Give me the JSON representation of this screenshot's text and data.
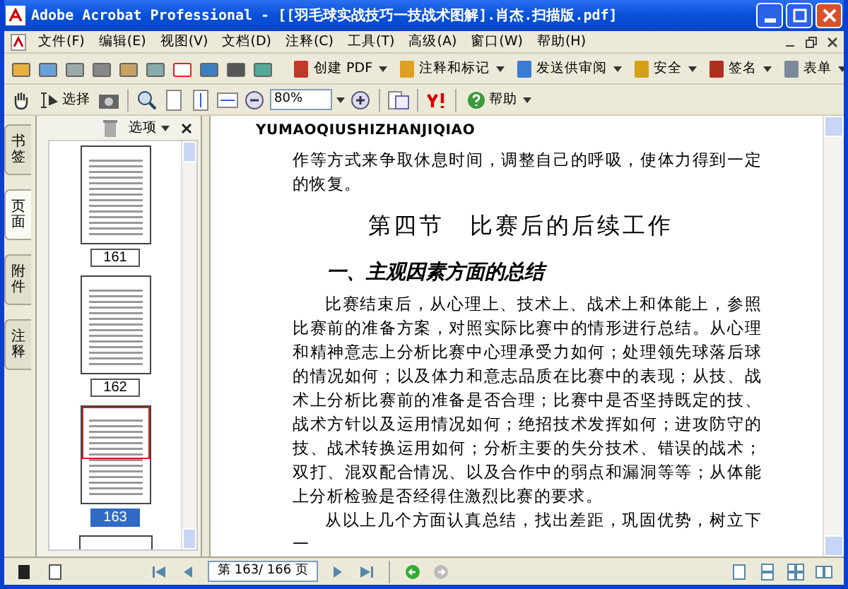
{
  "window": {
    "title": "Adobe Acrobat Professional - [[羽毛球实战技巧一技战术图解].肖杰.扫描版.pdf]"
  },
  "menu": [
    {
      "label": "文件(F)"
    },
    {
      "label": "编辑(E)"
    },
    {
      "label": "视图(V)"
    },
    {
      "label": "文档(D)"
    },
    {
      "label": "注释(C)"
    },
    {
      "label": "工具(T)"
    },
    {
      "label": "高级(A)"
    },
    {
      "label": "窗口(W)"
    },
    {
      "label": "帮助(H)"
    }
  ],
  "task_buttons": [
    {
      "label": "创建 PDF",
      "kind": "pdf"
    },
    {
      "label": "注释和标记",
      "kind": "comment"
    },
    {
      "label": "发送供审阅",
      "kind": "review"
    },
    {
      "label": "安全",
      "kind": "lock"
    },
    {
      "label": "签名",
      "kind": "pen"
    },
    {
      "label": "表单",
      "kind": "form"
    }
  ],
  "select_tool": {
    "label": "选择"
  },
  "zoom": {
    "value": "80%"
  },
  "help": {
    "label": "帮助"
  },
  "sidebar": {
    "tabs": [
      {
        "label": "书签",
        "selected": false
      },
      {
        "label": "页面",
        "selected": true
      },
      {
        "label": "附件",
        "selected": false
      },
      {
        "label": "注释",
        "selected": false
      }
    ],
    "options": "选项",
    "thumbnails": [
      {
        "label": "161",
        "selected": false
      },
      {
        "label": "162",
        "selected": false
      },
      {
        "label": "163",
        "selected": true
      }
    ]
  },
  "document": {
    "running_head": "YUMAOQIUSHIZHANJIQIAO",
    "blocks": [
      {
        "kind": "para",
        "indent": false,
        "text": "作等方式来争取休息时间，调整自己的呼吸，使体力得到一定的恢复。"
      },
      {
        "kind": "section",
        "text": "第四节　比赛后的后续工作"
      },
      {
        "kind": "subheading",
        "text": "一、主观因素方面的总结"
      },
      {
        "kind": "para",
        "indent": true,
        "text": "比赛结束后，从心理上、技术上、战术上和体能上，参照比赛前的准备方案，对照实际比赛中的情形进行总结。从心理和精神意志上分析比赛中心理承受力如何；处理领先球落后球的情况如何；以及体力和意志品质在比赛中的表现；从技、战术上分析比赛前的准备是否合理；比赛中是否坚持既定的技、战术方针以及运用情况如何；绝招技术发挥如何；进攻防守的技、战术转换运用如何；分析主要的失分技术、错误的战术；双打、混双配合情况、以及合作中的弱点和漏洞等等；从体能上分析检验是否经得住激烈比赛的要求。"
      },
      {
        "kind": "para",
        "indent": true,
        "text": "从以上几个方面认真总结，找出差距，巩固优势，树立下一"
      }
    ]
  },
  "status_bar": {
    "page_field": "第 163/ 166 页"
  }
}
